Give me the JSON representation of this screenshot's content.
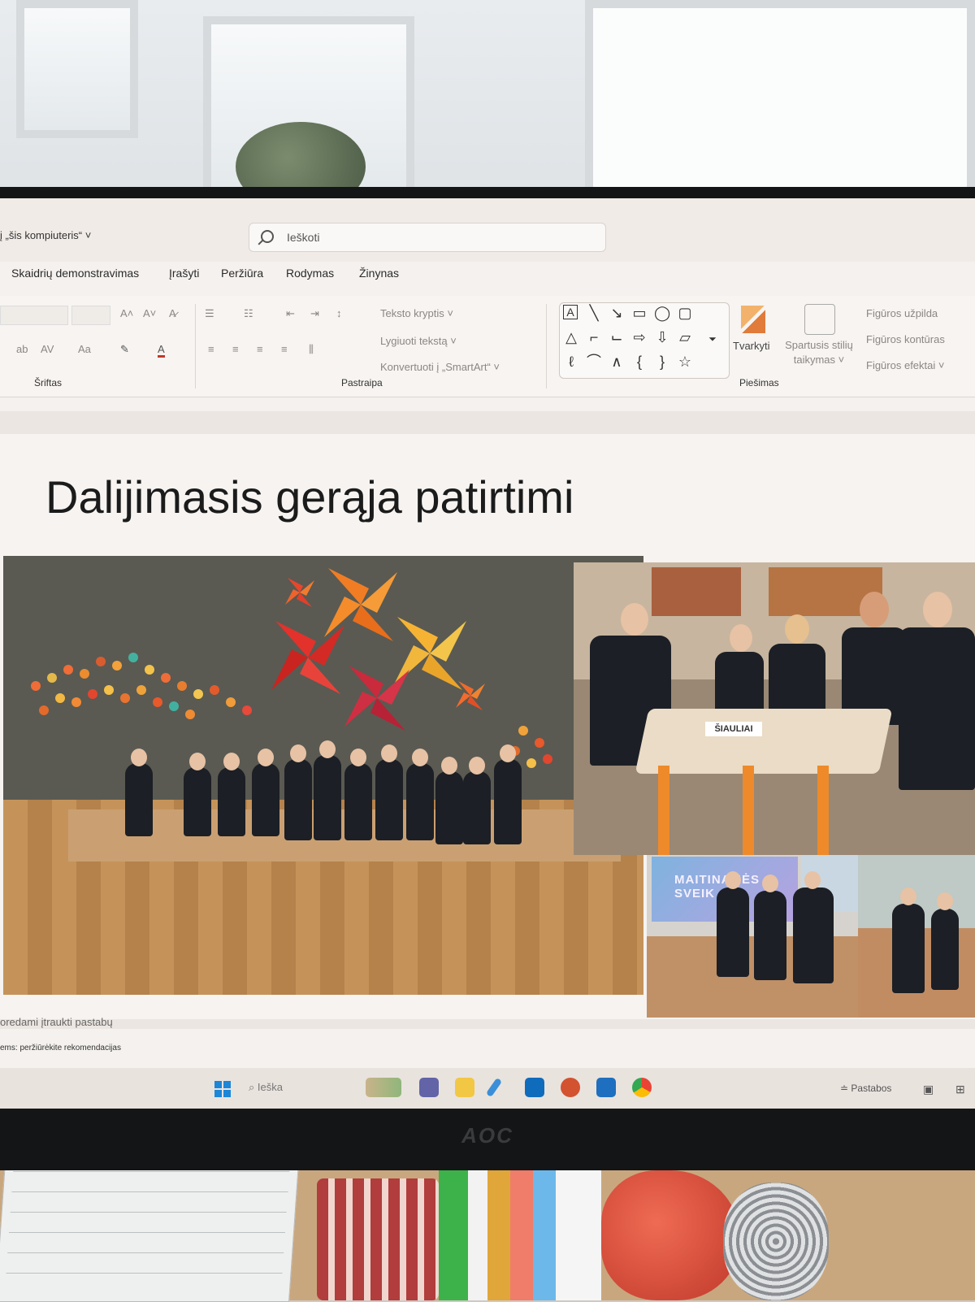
{
  "window": {
    "save_location": "į „šis kompiuteris“ ˅",
    "search_placeholder": "Ieškoti"
  },
  "menu_tabs": [
    "Skaidrių demonstravimas",
    "Įrašyti",
    "Peržiūra",
    "Rodymas",
    "Žinynas"
  ],
  "ribbon": {
    "font_group": "Šriftas",
    "paragraph_group": "Pastraipa",
    "drawing_group": "Piešimas",
    "text_direction": "Teksto kryptis ˅",
    "align_text": "Lygiuoti tekstą ˅",
    "convert_smartart": "Konvertuoti į „SmartArt“ ˅",
    "arrange": "Tvarkyti",
    "quick_styles": "Spartusis stilių taikymas ˅",
    "shape_fill": "Figūros užpilda",
    "shape_outline": "Figūros kontūras",
    "shape_effects": "Figūros efektai ˅"
  },
  "slide": {
    "title": "Dalijimasis gerąja patirtimi",
    "table_sign": "ŠIAULIAI",
    "tv_text": "MAITINAMĖS SVEIK"
  },
  "notes": {
    "hint": "oredami įtraukti pastabų",
    "recommendations": "ems: peržiūrėkite rekomendacijas"
  },
  "taskbar": {
    "search": "Ieška",
    "notes_button": "Pastabos"
  },
  "monitor_brand": "AOC",
  "colors": {
    "accent_blue": "#1c86d8",
    "text_dark": "#1b1b1b",
    "ribbon_bg": "#f7f4f1"
  }
}
